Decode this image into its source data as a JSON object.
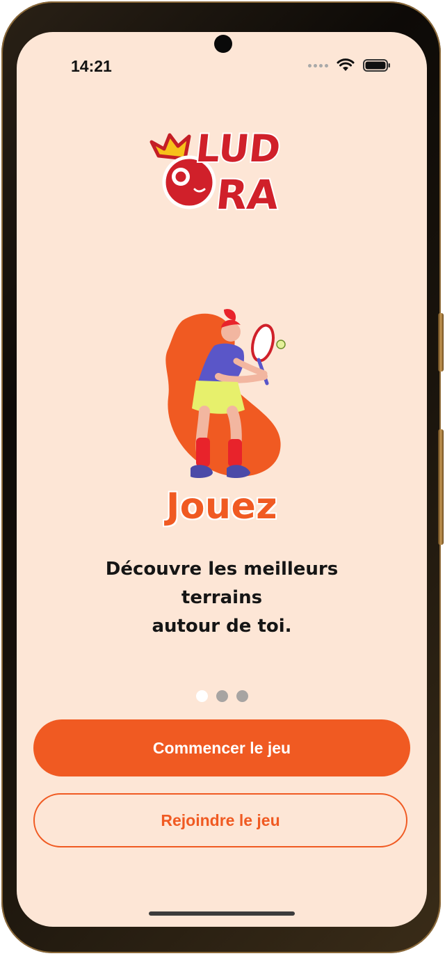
{
  "status_bar": {
    "time": "14:21",
    "icons": [
      "cellular-dots-icon",
      "wifi-icon",
      "battery-icon"
    ]
  },
  "logo": {
    "lines": [
      "LUD",
      "RA"
    ],
    "icons": [
      "crown-icon",
      "ball-mascot-icon"
    ]
  },
  "illustration": {
    "icon": "tennis-player-illustration"
  },
  "onboarding": {
    "title": "Jouez",
    "subtitle_line1": "Découvre les meilleurs terrains",
    "subtitle_line2": "autour de toi.",
    "pages_total": 3,
    "active_page": 1
  },
  "actions": {
    "primary_label": "Commencer le jeu",
    "secondary_label": "Rejoindre le jeu"
  },
  "colors": {
    "background": "#fde6d6",
    "accent": "#f05a22",
    "logo_red": "#d0202a",
    "logo_yellow": "#f7c21a",
    "text": "#151515",
    "dot_inactive": "#a7a4a2",
    "dot_active": "#ffffff"
  }
}
